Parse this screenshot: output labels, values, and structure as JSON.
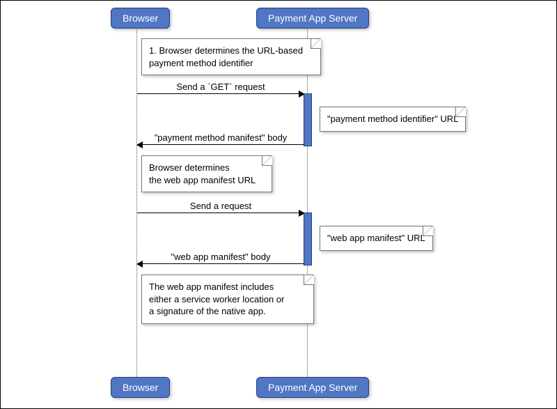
{
  "participants": {
    "browser": "Browser",
    "server": "Payment App Server"
  },
  "notes": {
    "n1_l1": "1. Browser determines the URL-based",
    "n1_l2": "payment method identifier",
    "n2_l1": "\"payment method identifier\" URL",
    "n3_l1": "Browser determines",
    "n3_l2": "the web app manifest URL",
    "n4_l1": "\"web app manifest\" URL",
    "n5_l1": "The web app manifest includes",
    "n5_l2": "either a service worker location or",
    "n5_l3": "a signature of the native app."
  },
  "messages": {
    "m1": "Send a `GET` request",
    "m2": "\"payment method manifest\" body",
    "m3": "Send a request",
    "m4": "\"web app manifest\" body"
  }
}
